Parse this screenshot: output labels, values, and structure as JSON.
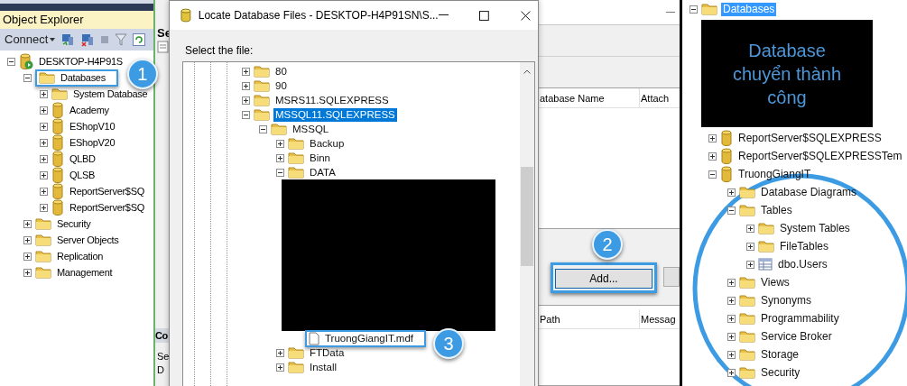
{
  "object_explorer": {
    "title": "Object Explorer",
    "connect": "Connect",
    "tree": [
      {
        "label": "DESKTOP-H4P91S",
        "kind": "server",
        "expanded": true,
        "children": [
          {
            "label": "Databases",
            "kind": "folder",
            "expanded": true,
            "callout": "1",
            "children": [
              {
                "label": "System Database",
                "kind": "folder",
                "expanded": false
              },
              {
                "label": "Academy",
                "kind": "database",
                "expanded": false
              },
              {
                "label": "EShopV10",
                "kind": "database",
                "expanded": false
              },
              {
                "label": "EShopV20",
                "kind": "database",
                "expanded": false
              },
              {
                "label": "QLBD",
                "kind": "database",
                "expanded": false
              },
              {
                "label": "QLSB",
                "kind": "database",
                "expanded": false
              },
              {
                "label": "ReportServer$SQ",
                "kind": "database",
                "expanded": false
              },
              {
                "label": "ReportServer$SQ",
                "kind": "database",
                "expanded": false
              }
            ]
          },
          {
            "label": "Security",
            "kind": "folder",
            "expanded": false
          },
          {
            "label": "Server Objects",
            "kind": "folder",
            "expanded": false
          },
          {
            "label": "Replication",
            "kind": "folder",
            "expanded": false
          },
          {
            "label": "Management",
            "kind": "folder",
            "expanded": false
          }
        ]
      }
    ]
  },
  "attach_dialog": {
    "top_heading": "Se",
    "bottom_heading": "Co",
    "bottom_lines": [
      "Se",
      "D"
    ],
    "databases_grid": {
      "columns": [
        "atabase Name",
        "Attach"
      ]
    },
    "add_button": {
      "label": "Add...",
      "callout": "2"
    },
    "details_grid": {
      "columns": [
        "Path",
        "Messag"
      ]
    }
  },
  "locate_dialog": {
    "title": "Locate Database Files - DESKTOP-H4P91SN\\S...",
    "prompt": "Select the file:",
    "tree": [
      {
        "label": "80",
        "kind": "folder",
        "expanded": false,
        "selected": false
      },
      {
        "label": "90",
        "kind": "folder",
        "expanded": false,
        "selected": false
      },
      {
        "label": "MSRS11.SQLEXPRESS",
        "kind": "folder",
        "expanded": false,
        "selected": false
      },
      {
        "label": "MSSQL11.SQLEXPRESS",
        "kind": "folder",
        "expanded": true,
        "selected": true,
        "children": [
          {
            "label": "MSSQL",
            "kind": "folder",
            "expanded": true,
            "selected": false,
            "children": [
              {
                "label": "Backup",
                "kind": "folder",
                "expanded": false,
                "selected": false
              },
              {
                "label": "Binn",
                "kind": "folder",
                "expanded": false,
                "selected": false
              },
              {
                "label": "DATA",
                "kind": "folder",
                "expanded": true,
                "selected": false,
                "redacted": true,
                "children": [
                  {
                    "label": "TruongGiangIT.mdf",
                    "kind": "file",
                    "selected": false,
                    "callout": "3"
                  }
                ]
              },
              {
                "label": "FTData",
                "kind": "folder",
                "expanded": false,
                "selected": false
              },
              {
                "label": "Install",
                "kind": "folder",
                "expanded": false,
                "selected": false
              }
            ]
          }
        ]
      }
    ]
  },
  "result_panel": {
    "caption": "Database chuyển thành công",
    "tree": [
      {
        "label": "Databases",
        "kind": "folder",
        "expanded": true,
        "selected": true,
        "children": [
          {
            "label": "ReportServer$SQLEXPRESS",
            "kind": "database",
            "expanded": false,
            "selected": false
          },
          {
            "label": "ReportServer$SQLEXPRESSTem",
            "kind": "database",
            "expanded": false,
            "selected": false
          },
          {
            "label": "TruongGiangIT",
            "kind": "database",
            "expanded": true,
            "selected": false,
            "children": [
              {
                "label": "Database Diagrams",
                "kind": "folder",
                "expanded": false,
                "selected": false
              },
              {
                "label": "Tables",
                "kind": "folder",
                "expanded": true,
                "selected": false,
                "children": [
                  {
                    "label": "System Tables",
                    "kind": "folder",
                    "expanded": false,
                    "selected": false
                  },
                  {
                    "label": "FileTables",
                    "kind": "folder",
                    "expanded": false,
                    "selected": false
                  },
                  {
                    "label": "dbo.Users",
                    "kind": "table",
                    "expanded": false,
                    "selected": false
                  }
                ]
              },
              {
                "label": "Views",
                "kind": "folder",
                "expanded": false,
                "selected": false
              },
              {
                "label": "Synonyms",
                "kind": "folder",
                "expanded": false,
                "selected": false
              },
              {
                "label": "Programmability",
                "kind": "folder",
                "expanded": false,
                "selected": false
              },
              {
                "label": "Service Broker",
                "kind": "folder",
                "expanded": false,
                "selected": false
              },
              {
                "label": "Storage",
                "kind": "folder",
                "expanded": false,
                "selected": false
              },
              {
                "label": "Security",
                "kind": "folder",
                "expanded": false,
                "selected": false
              }
            ]
          }
        ]
      }
    ]
  }
}
